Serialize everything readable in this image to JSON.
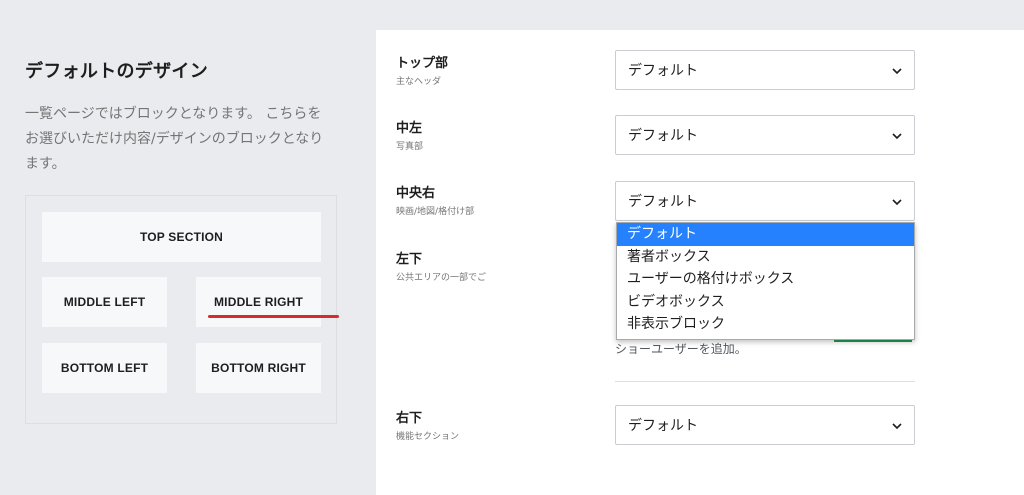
{
  "left": {
    "title": "デフォルトのデザイン",
    "description": "一覧ページではブロックとなります。 こちらをお選びいただけ内容/デザインのブロックとなります。",
    "blocks": {
      "top": "TOP SECTION",
      "middle_left": "MIDDLE LEFT",
      "middle_right": "MIDDLE RIGHT",
      "bottom_left": "BOTTOM LEFT",
      "bottom_right": "BOTTOM RIGHT"
    }
  },
  "rows": {
    "top": {
      "title": "トップ部",
      "sub": "主なヘッダ",
      "value": "デフォルト"
    },
    "middle_left": {
      "title": "中左",
      "sub": "写真部",
      "value": "デフォルト"
    },
    "middle_right": {
      "title": "中央右",
      "sub": "映画/地図/格付け部",
      "value": "デフォルト"
    },
    "bottom_left": {
      "title": "左下",
      "sub": "公共エリアの一部でご"
    },
    "bottom_right": {
      "title": "右下",
      "sub": "機能セクション",
      "value": "デフォルト"
    }
  },
  "dropdown": {
    "options": [
      "デフォルト",
      "著者ボックス",
      "ユーザーの格付けボックス",
      "ビデオボックス",
      "非表示ブロック"
    ],
    "selected_index": 0
  },
  "help_text": "ショーユーザーを追加。",
  "colors": {
    "highlight": "#2681ff",
    "annotation_red": "#d42d2d",
    "toggle_green": "#1f9d55"
  },
  "icons": {
    "select_arrow": "chevron-down-icon"
  }
}
